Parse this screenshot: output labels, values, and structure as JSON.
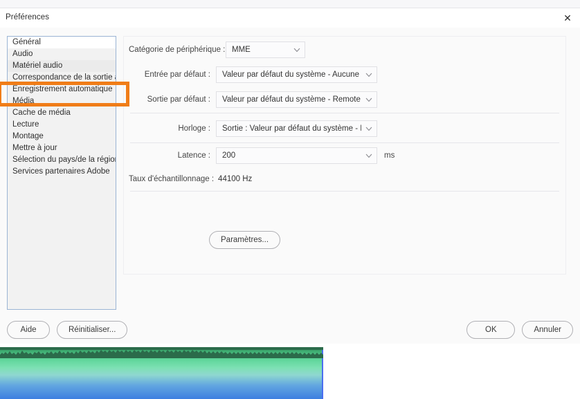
{
  "window": {
    "title": "Préférences",
    "close_icon": "close-icon",
    "close_glyph": "✕"
  },
  "sidebar": {
    "items": [
      {
        "label": "Général"
      },
      {
        "label": "Audio"
      },
      {
        "label": "Matériel audio"
      },
      {
        "label": "Correspondance de la sortie audio"
      },
      {
        "label": "Enregistrement automatique"
      },
      {
        "label": "Média"
      },
      {
        "label": "Cache de média"
      },
      {
        "label": "Lecture"
      },
      {
        "label": "Montage"
      },
      {
        "label": "Mettre à jour"
      },
      {
        "label": "Sélection du pays/de la région"
      },
      {
        "label": "Services partenaires Adobe"
      }
    ],
    "selected": "Matériel audio"
  },
  "highlight": {
    "color": "#f07d18",
    "target": "Matériel audio"
  },
  "ghost": {
    "text": ""
  },
  "form": {
    "device_category": {
      "label": "Catégorie de périphérique :",
      "value": "MME",
      "chevron_icon": "chevron-down-icon"
    },
    "default_input": {
      "label": "Entrée par défaut :",
      "value": "Valeur par défaut du système - Aucune entr...",
      "chevron_icon": "chevron-down-icon"
    },
    "default_output": {
      "label": "Sortie par défaut :",
      "value": "Valeur par défaut du système - Remote Audio",
      "chevron_icon": "chevron-down-icon"
    },
    "clock": {
      "label": "Horloge :",
      "value": "Sortie : Valeur par défaut du système - Rem...",
      "chevron_icon": "chevron-down-icon"
    },
    "latency": {
      "label": "Latence :",
      "value": "200",
      "unit": "ms",
      "chevron_icon": "chevron-down-icon"
    },
    "sample_rate": {
      "label": "Taux d'échantillonnage :",
      "value": "44100 Hz"
    },
    "settings_button": "Paramètres..."
  },
  "footer": {
    "help": "Aide",
    "reset": "Réinitialiser...",
    "ok": "OK",
    "cancel": "Annuler"
  },
  "timeline": {
    "clip_name": "audio-waveform-clip",
    "colors": {
      "wave_top": "#2b6b4a",
      "wave_mid": "#5fd69a",
      "wave_bottom": "#3d7fe0",
      "playhead": "#4a6ef0"
    }
  }
}
